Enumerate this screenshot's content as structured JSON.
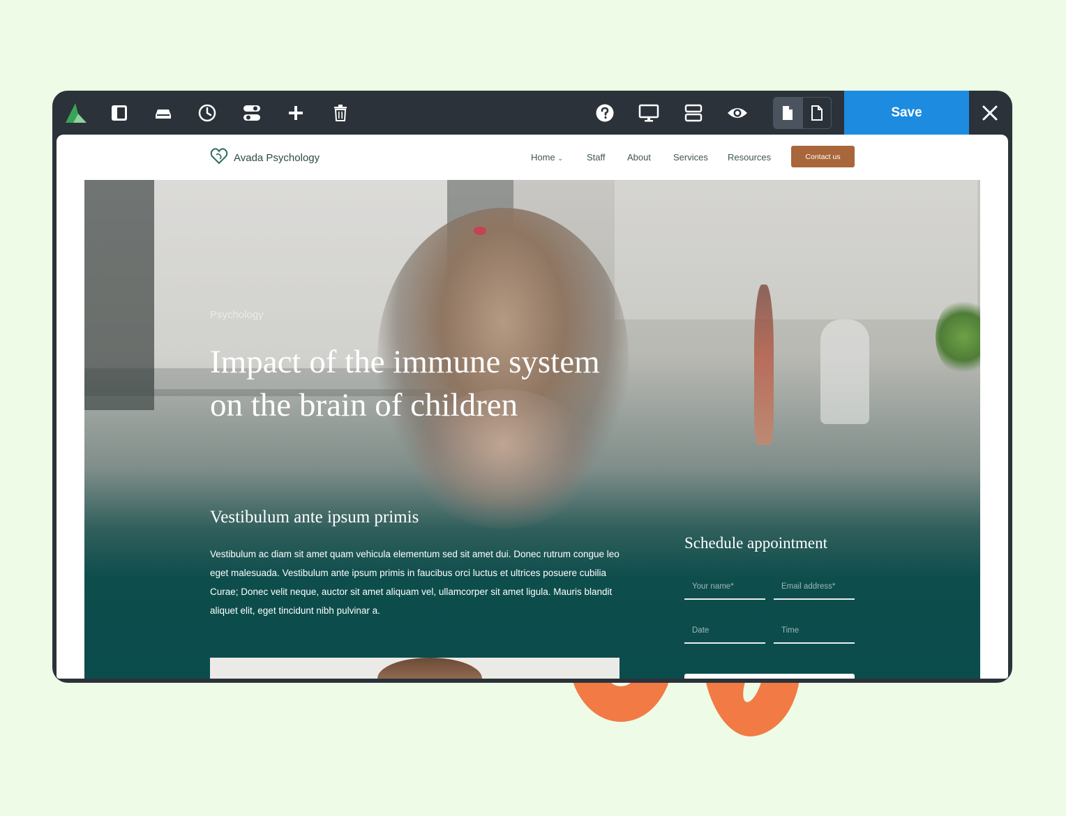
{
  "toolbar": {
    "left_icons": [
      "avada-logo-icon",
      "sidebar-panel-icon",
      "container-icon",
      "history-icon",
      "toggles-icon",
      "add-icon",
      "trash-icon"
    ],
    "right_icons": [
      "help-icon",
      "desktop-preview-icon",
      "layout-icon",
      "preview-eye-icon"
    ],
    "page_buttons": [
      "page-icon",
      "page-outline-icon"
    ],
    "save_label": "Save",
    "close_icon": "close-icon",
    "colors": {
      "bar": "#2b323a",
      "save": "#1d8be0",
      "logo_dark": "#3aa35b",
      "logo_light": "#8fd39c"
    }
  },
  "site": {
    "brand": "Avada Psychology",
    "nav": [
      "Home",
      "Staff",
      "About",
      "Services",
      "Resources"
    ],
    "contact_label": "Contact us",
    "colors": {
      "accent": "#a8663a",
      "hero_dark": "#0b4c4c"
    }
  },
  "hero": {
    "category": "Psychology",
    "title_line1": "Impact of the immune system",
    "title_line2": "on the brain of children"
  },
  "article": {
    "subheading": "Vestibulum ante ipsum primis",
    "body": "Vestibulum ac diam sit amet quam vehicula elementum sed sit amet dui. Donec rutrum congue leo eget malesuada. Vestibulum ante ipsum primis in faucibus orci luctus et ultrices posuere cubilia Curae; Donec velit neque, auctor sit amet aliquam vel, ullamcorper sit amet ligula. Mauris blandit aliquet elit, eget tincidunt nibh pulvinar a."
  },
  "appointment": {
    "title": "Schedule appointment",
    "fields": {
      "name": "Your name*",
      "email": "Email address*",
      "date": "Date",
      "time": "Time"
    }
  }
}
